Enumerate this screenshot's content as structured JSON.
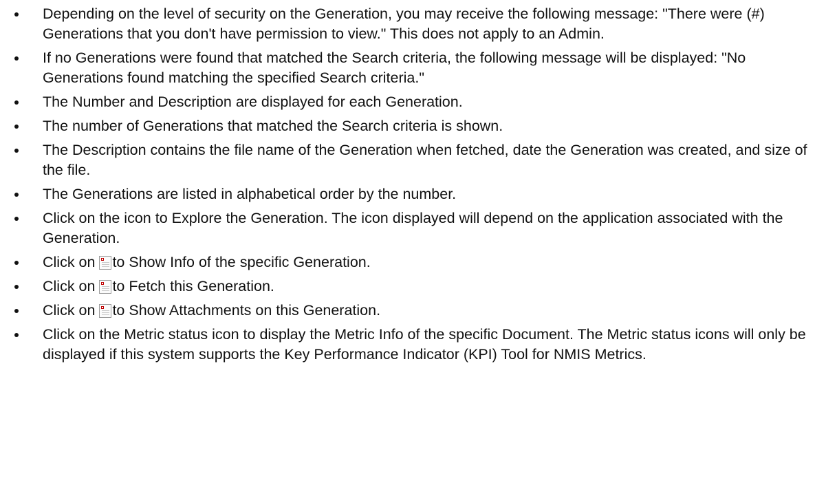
{
  "bullets": [
    {
      "text": "Depending on the level of security on the Generation, you may receive the following message: \"There were (#) Generations that you don't have permission to view.\" This does not apply to an Admin."
    },
    {
      "text": "If no Generations were found that matched the Search criteria, the following message will be displayed: \"No Generations found matching the specified Search criteria.\""
    },
    {
      "text": "The Number and Description are displayed for each Generation."
    },
    {
      "text": "The number of Generations that matched the Search criteria is shown."
    },
    {
      "text": "The Description contains the file name of the Generation when fetched, date the Generation was created, and size of the file."
    },
    {
      "text": "The Generations are listed in alphabetical order by the number."
    },
    {
      "text": "Click on the icon to Explore the Generation. The icon displayed will depend on the application associated with the Generation."
    },
    {
      "before": "Click on ",
      "after": "to Show Info of the specific Generation.",
      "icon": "broken-image-icon"
    },
    {
      "before": "Click on ",
      "after": "to Fetch this Generation.",
      "icon": "broken-image-icon"
    },
    {
      "before": "Click on ",
      "after": "to Show Attachments on this Generation.",
      "icon": "broken-image-icon"
    },
    {
      "text": "Click on the Metric status icon to display the Metric Info of the specific Document. The Metric status icons will only be displayed if this system supports the Key Performance Indicator (KPI) Tool for NMIS Metrics."
    }
  ]
}
